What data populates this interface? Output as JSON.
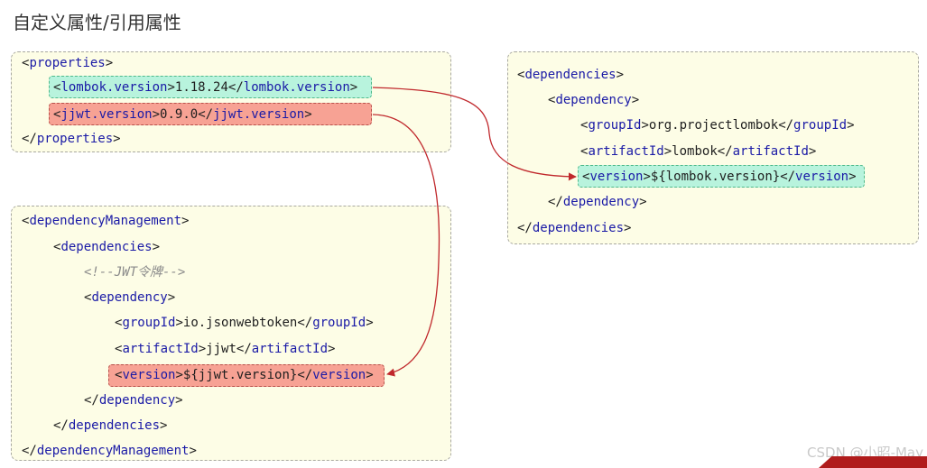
{
  "page": {
    "title": "自定义属性/引用属性"
  },
  "properties_box": {
    "open": {
      "tag": "properties"
    },
    "lombok": {
      "tag": "lombok.version",
      "value": "1.18.24"
    },
    "jjwt": {
      "tag": "jjwt.version",
      "value": "0.9.0"
    },
    "close": {
      "tag": "properties"
    }
  },
  "management_box": {
    "open_mgmt": {
      "tag": "dependencyManagement"
    },
    "open_deps": {
      "tag": "dependencies"
    },
    "comment": "<!--JWT令牌-->",
    "open_dep": {
      "tag": "dependency"
    },
    "group": {
      "tag": "groupId",
      "value": "io.jsonwebtoken"
    },
    "artifact": {
      "tag": "artifactId",
      "value": "jjwt"
    },
    "version": {
      "tag": "version",
      "value": "${jjwt.version}"
    },
    "close_dep": {
      "tag": "dependency"
    },
    "close_deps": {
      "tag": "dependencies"
    },
    "close_mgmt": {
      "tag": "dependencyManagement"
    }
  },
  "dependencies_box": {
    "open_deps": {
      "tag": "dependencies"
    },
    "open_dep": {
      "tag": "dependency"
    },
    "group": {
      "tag": "groupId",
      "value": "org.projectlombok"
    },
    "artifact": {
      "tag": "artifactId",
      "value": "lombok"
    },
    "version": {
      "tag": "version",
      "value": "${lombok.version}"
    },
    "close_dep": {
      "tag": "dependency"
    },
    "close_deps": {
      "tag": "dependencies"
    }
  },
  "watermark": "CSDN @小昭-May",
  "colors": {
    "box_bg": "#fdfde6",
    "green_highlight": "#b8f3dd",
    "red_highlight": "#f7a294",
    "tag_text": "#1a1aa6",
    "arrow": "#c0282c"
  }
}
